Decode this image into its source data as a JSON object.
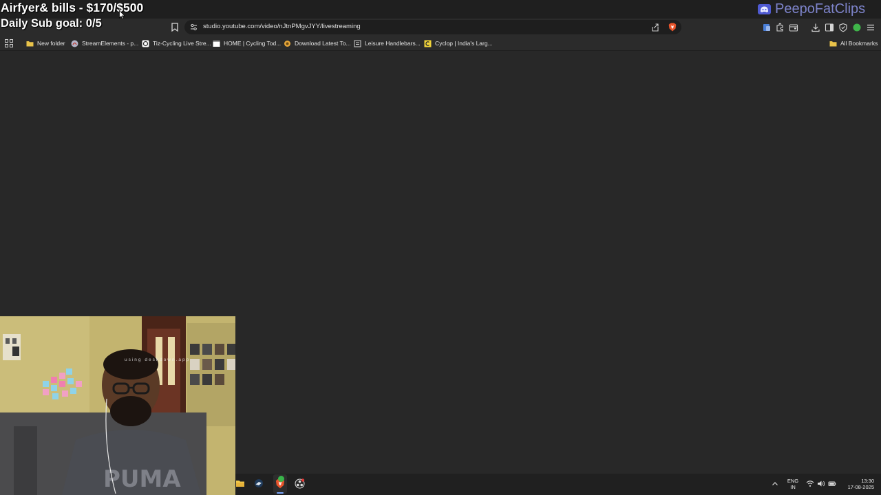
{
  "overlay": {
    "goal_text": "Airfyer& bills - $170/$500",
    "sub_goal_text": "Daily Sub goal: 0/5",
    "channel_name": "PeepoFatClips",
    "webcam_watermark": "using deskdown.app"
  },
  "browser": {
    "url": "studio.youtube.com/video/nJtnPMgvJYY/livestreaming",
    "bookmarks": [
      {
        "label": "New folder",
        "icon": "folder-icon"
      },
      {
        "label": "StreamElements - p...",
        "icon": "streamelements-icon"
      },
      {
        "label": "Tiz-Cycling Live Stre...",
        "icon": "tiz-cycling-icon"
      },
      {
        "label": "HOME | Cycling Tod...",
        "icon": "page-icon"
      },
      {
        "label": "Download Latest To...",
        "icon": "download-site-icon"
      },
      {
        "label": "Leisure Handlebars...",
        "icon": "page-icon"
      },
      {
        "label": "Cyclop | India's Larg...",
        "icon": "cyclop-icon"
      }
    ],
    "all_bookmarks_label": "All Bookmarks"
  },
  "taskbar": {
    "language_top": "ENG",
    "language_bottom": "IN",
    "time": "13:30",
    "date": "17-08-2025"
  },
  "colors": {
    "page_background": "#282828",
    "chrome_background": "#2b2b2b",
    "channel_name": "#8e95e8",
    "brave_accent": "#e8542b"
  }
}
